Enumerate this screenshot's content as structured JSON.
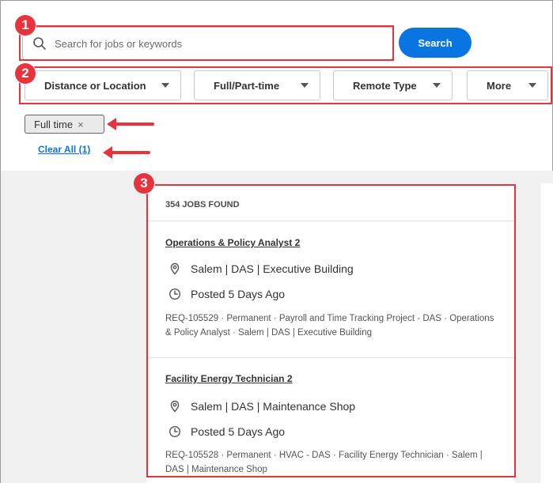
{
  "search": {
    "placeholder": "Search for jobs or keywords",
    "button_label": "Search"
  },
  "filters": [
    {
      "label": "Distance or Location"
    },
    {
      "label": "Full/Part-time"
    },
    {
      "label": "Remote Type"
    },
    {
      "label": "More"
    }
  ],
  "active_filter": {
    "label": "Full time",
    "remove_glyph": "×"
  },
  "clear_all": "Clear All (1)",
  "results": {
    "count_label": "354 JOBS FOUND",
    "jobs": [
      {
        "title": "Operations & Policy Analyst 2",
        "location": "Salem | DAS | Executive Building",
        "posted": "Posted 5 Days Ago",
        "details": "REQ-105529 · Permanent · Payroll and Time Tracking Project - DAS · Operations & Policy Analyst · Salem | DAS | Executive Building"
      },
      {
        "title": "Facility Energy Technician 2",
        "location": "Salem | DAS | Maintenance Shop",
        "posted": "Posted 5 Days Ago",
        "details": "REQ-105528 · Permanent · HVAC - DAS · Facility Energy Technician · Salem | DAS | Maintenance Shop"
      }
    ]
  },
  "annotations": {
    "badges": [
      "1",
      "2",
      "3"
    ]
  },
  "icons": {
    "search": "search-icon",
    "location": "location-pin-icon",
    "clock": "clock-icon",
    "caret": "chevron-down-icon",
    "arrow": "arrow-left-icon"
  },
  "colors": {
    "accent": "#0875e1",
    "annotation": "#e8323c",
    "background_grey": "#f0f0f0"
  }
}
